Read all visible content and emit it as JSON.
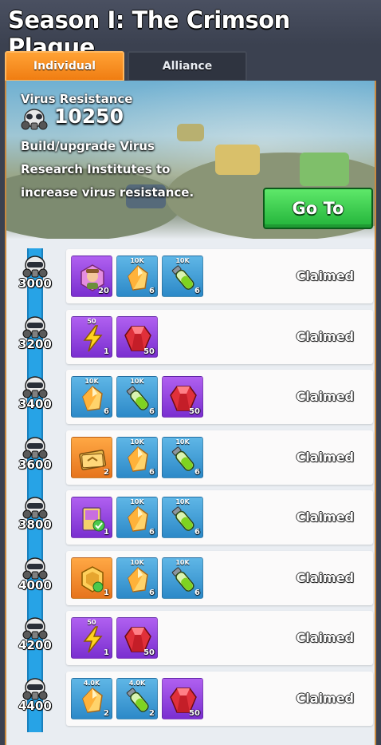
{
  "title": "Season I: The Crimson Plague",
  "tabs": [
    {
      "label": "Individual",
      "active": true
    },
    {
      "label": "Alliance",
      "active": false
    }
  ],
  "banner": {
    "label": "Virus Resistance",
    "value": "10250",
    "description_lines": [
      "Build/upgrade Virus",
      "Research Institutes to",
      "increase virus resistance."
    ],
    "goto_label": "Go To"
  },
  "rows": [
    {
      "milestone": "3000",
      "status": "Claimed",
      "rewards": [
        {
          "type": "avatar",
          "color": "purple",
          "top": "",
          "qty": "20"
        },
        {
          "type": "crystal",
          "color": "blue",
          "top": "10K",
          "qty": "6"
        },
        {
          "type": "vial",
          "color": "blue",
          "top": "10K",
          "qty": "6"
        }
      ]
    },
    {
      "milestone": "3200",
      "status": "Claimed",
      "rewards": [
        {
          "type": "bolt",
          "color": "purple",
          "top": "50",
          "qty": "1"
        },
        {
          "type": "gem",
          "color": "purple",
          "top": "",
          "qty": "50"
        }
      ]
    },
    {
      "milestone": "3400",
      "status": "Claimed",
      "rewards": [
        {
          "type": "crystal",
          "color": "blue",
          "top": "10K",
          "qty": "6"
        },
        {
          "type": "vial",
          "color": "blue",
          "top": "10K",
          "qty": "6"
        },
        {
          "type": "gem",
          "color": "purple",
          "top": "",
          "qty": "50"
        }
      ]
    },
    {
      "milestone": "3600",
      "status": "Claimed",
      "rewards": [
        {
          "type": "card",
          "color": "orange",
          "top": "",
          "qty": "2"
        },
        {
          "type": "crystal",
          "color": "blue",
          "top": "10K",
          "qty": "6"
        },
        {
          "type": "vial",
          "color": "blue",
          "top": "10K",
          "qty": "6"
        }
      ]
    },
    {
      "milestone": "3800",
      "status": "Claimed",
      "rewards": [
        {
          "type": "book",
          "color": "purple",
          "top": "",
          "qty": "1"
        },
        {
          "type": "crystal",
          "color": "blue",
          "top": "10K",
          "qty": "6"
        },
        {
          "type": "vial",
          "color": "blue",
          "top": "10K",
          "qty": "6"
        }
      ]
    },
    {
      "milestone": "4000",
      "status": "Claimed",
      "rewards": [
        {
          "type": "badge",
          "color": "orange",
          "top": "",
          "qty": "1"
        },
        {
          "type": "crystal",
          "color": "blue",
          "top": "10K",
          "qty": "6"
        },
        {
          "type": "vial",
          "color": "blue",
          "top": "10K",
          "qty": "6"
        }
      ]
    },
    {
      "milestone": "4200",
      "status": "Claimed",
      "rewards": [
        {
          "type": "bolt",
          "color": "purple",
          "top": "50",
          "qty": "1"
        },
        {
          "type": "gem",
          "color": "purple",
          "top": "",
          "qty": "50"
        }
      ]
    },
    {
      "milestone": "4400",
      "status": "Claimed",
      "rewards": [
        {
          "type": "crystal",
          "color": "blue",
          "top": "4.0K",
          "qty": "2"
        },
        {
          "type": "vial",
          "color": "blue",
          "top": "4.0K",
          "qty": "2"
        },
        {
          "type": "gem",
          "color": "purple",
          "top": "",
          "qty": "50"
        }
      ]
    }
  ]
}
